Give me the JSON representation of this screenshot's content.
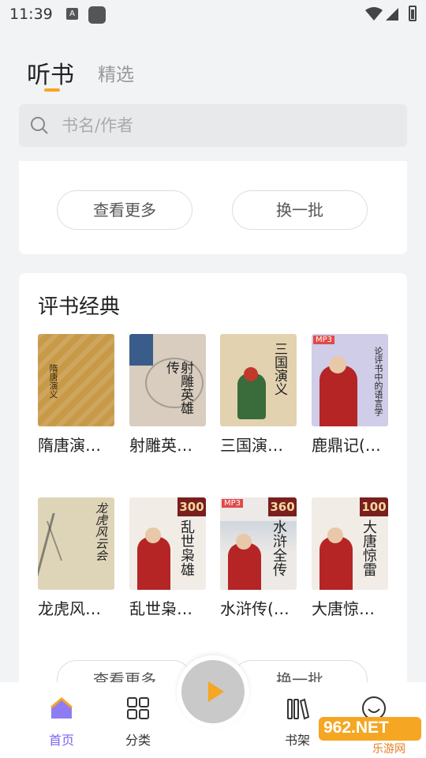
{
  "status": {
    "time": "11:39",
    "icon_a": "A"
  },
  "header": {
    "tabs": [
      {
        "label": "听书",
        "active": true
      },
      {
        "label": "精选",
        "active": false
      }
    ]
  },
  "search": {
    "placeholder": "书名/作者"
  },
  "top_card": {
    "more_label": "查看更多",
    "swap_label": "换一批"
  },
  "section": {
    "title": "评书经典",
    "books": [
      {
        "title": "隋唐演…",
        "cover_text": "隋唐演义",
        "cover_bg": "#c89a48"
      },
      {
        "title": "射雕英…",
        "cover_text": "射雕英雄传",
        "cover_bg": "#d8cdbf"
      },
      {
        "title": "三国演…",
        "cover_text": "三国演义",
        "cover_bg": "#e2d2b0"
      },
      {
        "title": "鹿鼎记(…",
        "cover_text": "论评书中的语言学",
        "cover_bg": "#cfcde8"
      },
      {
        "title": "龙虎风…",
        "cover_text": "龙虎风云会",
        "cover_bg": "#ded4b8"
      },
      {
        "title": "乱世枭…",
        "cover_text": "乱世枭雄",
        "cover_badge": "300",
        "cover_bg": "#f1ece6"
      },
      {
        "title": "水浒传(…",
        "cover_text": "水浒全传",
        "cover_badge": "360",
        "cover_bg": "#ece9e6"
      },
      {
        "title": "大唐惊…",
        "cover_text": "大唐惊雷",
        "cover_badge": "100",
        "cover_bg": "#f1ece6"
      }
    ],
    "more_label": "查看更多",
    "swap_label": "换一批"
  },
  "nav": [
    {
      "label": "首页",
      "icon": "home-icon",
      "active": true
    },
    {
      "label": "分类",
      "icon": "grid-icon",
      "active": false
    },
    {
      "label": "书架",
      "icon": "bookshelf-icon",
      "active": false
    },
    {
      "label": "",
      "icon": "smile-icon",
      "active": false
    }
  ],
  "watermark": {
    "text": "962.NET",
    "sub": "乐游网"
  },
  "colors": {
    "accent": "#f5a623",
    "nav_active": "#7b67f0"
  }
}
